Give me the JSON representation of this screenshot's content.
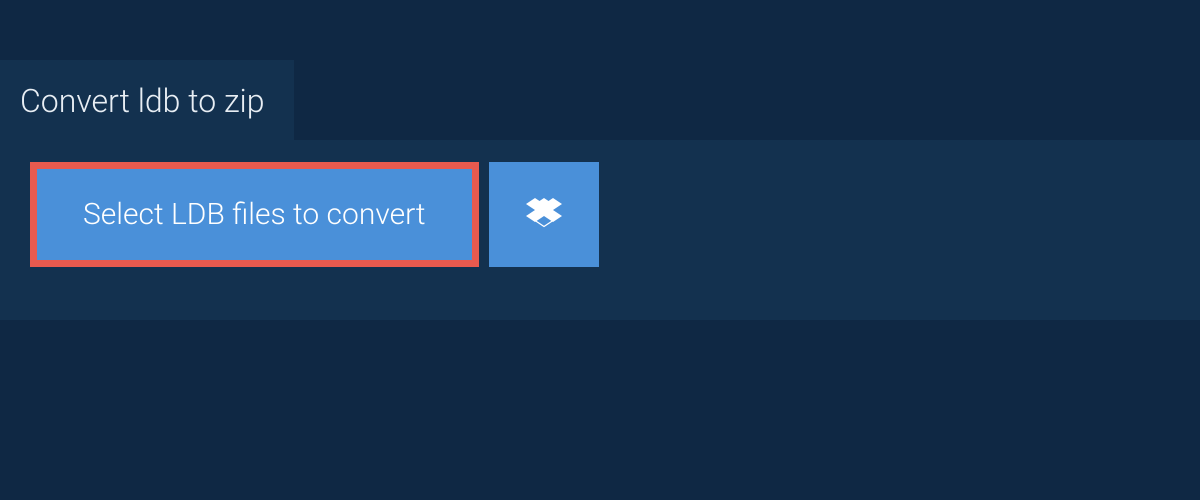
{
  "tab": {
    "label": "Convert ldb to zip"
  },
  "actions": {
    "select_files_label": "Select LDB files to convert"
  },
  "icons": {
    "dropbox": "dropbox-icon"
  },
  "colors": {
    "background": "#0f2844",
    "panel": "#13314f",
    "button": "#4a90d9",
    "highlight_border": "#e85a4f",
    "text_light": "#ffffff"
  }
}
